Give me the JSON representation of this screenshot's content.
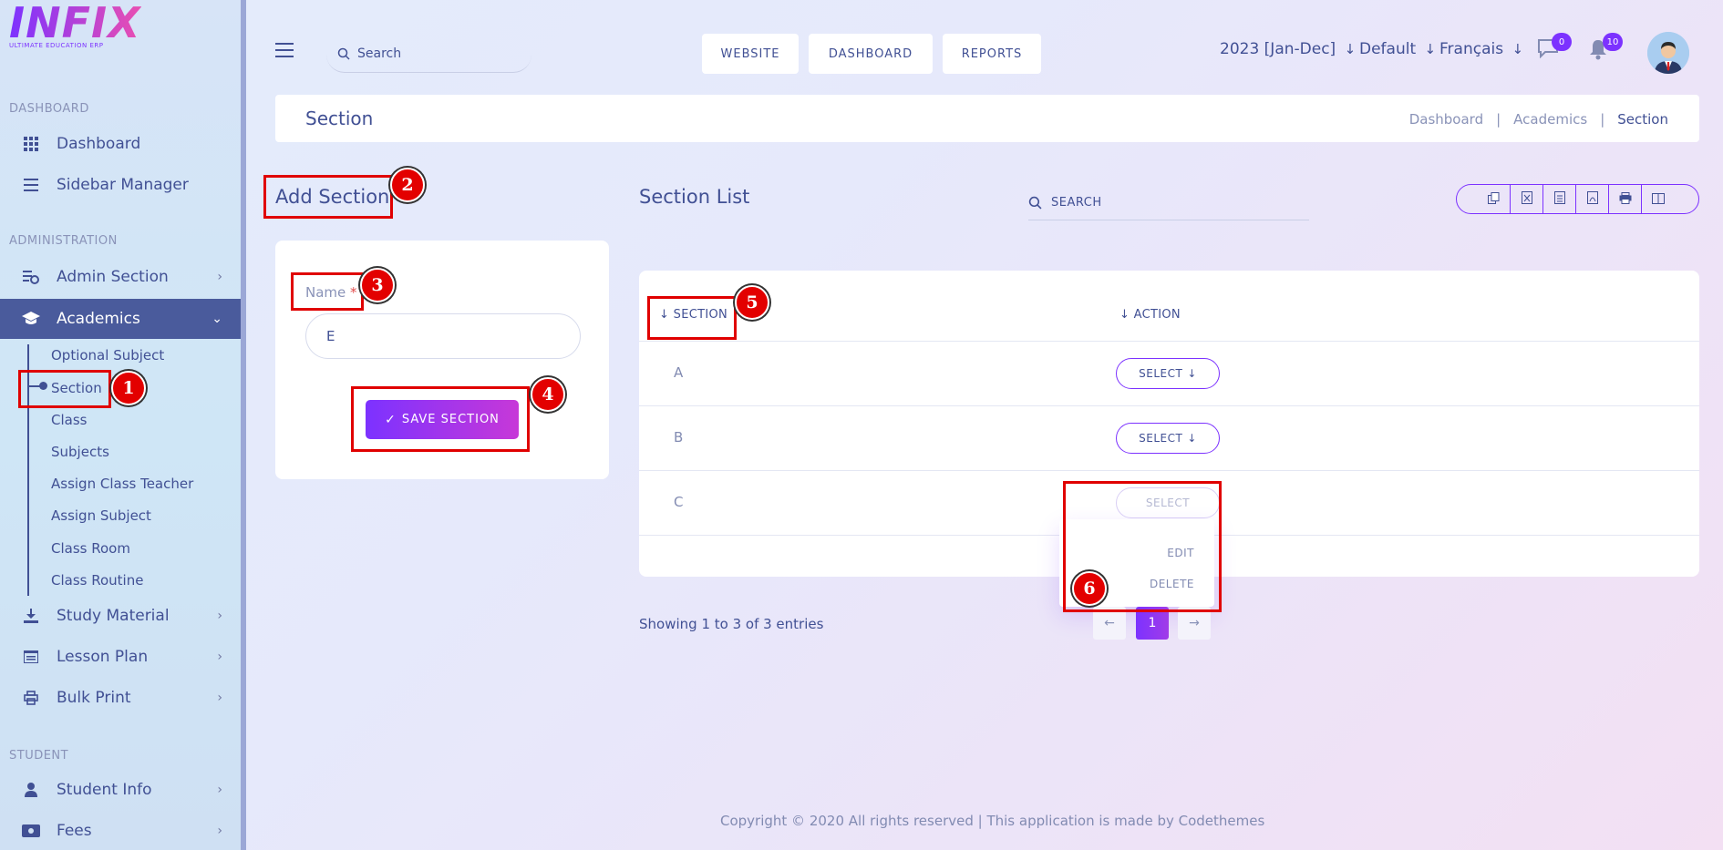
{
  "sidebar": {
    "logo_text": "INFIX",
    "logo_sub": "ULTIMATE EDUCATION ERP",
    "section_dashboard": "DASHBOARD",
    "item_dashboard": "Dashboard",
    "item_sidebar_manager": "Sidebar Manager",
    "section_administration": "ADMINISTRATION",
    "item_admin_section": "Admin Section",
    "item_academics": "Academics",
    "academics_sub": [
      "Optional Subject",
      "Section",
      "Class",
      "Subjects",
      "Assign Class Teacher",
      "Assign Subject",
      "Class Room",
      "Class Routine"
    ],
    "item_study_material": "Study Material",
    "item_lesson_plan": "Lesson Plan",
    "item_bulk_print": "Bulk Print",
    "section_student": "STUDENT",
    "item_student_info": "Student Info",
    "item_fees": "Fees"
  },
  "header": {
    "search_placeholder": "Search",
    "btn_website": "WEBSITE",
    "btn_dashboard": "DASHBOARD",
    "btn_reports": "REPORTS",
    "year": "2023 [Jan-Dec]",
    "theme": "Default",
    "language": "Français",
    "messages_count": "0",
    "notifications_count": "10"
  },
  "page": {
    "title": "Section",
    "breadcrumb": [
      "Dashboard",
      "Academics",
      "Section"
    ]
  },
  "add_section": {
    "heading": "Add Section",
    "name_label": "Name",
    "required_mark": "*",
    "name_value": "E",
    "save_label": "SAVE SECTION"
  },
  "section_list": {
    "heading": "Section List",
    "search_placeholder": "SEARCH",
    "col_section": "SECTION",
    "col_action": "ACTION",
    "rows": [
      {
        "section": "A",
        "action": "SELECT"
      },
      {
        "section": "B",
        "action": "SELECT"
      },
      {
        "section": "C",
        "action": "SELECT"
      }
    ],
    "dropdown_edit": "EDIT",
    "dropdown_delete": "DELETE",
    "entries_text": "Showing 1 to 3 of 3 entries",
    "page_current": "1"
  },
  "footer": {
    "text": "Copyright © 2020 All rights reserved | This application is made by Codethemes"
  },
  "annotations": [
    "1",
    "2",
    "3",
    "4",
    "5",
    "6"
  ],
  "colors": {
    "accent": "#7c32ff",
    "text": "#415094",
    "annotation": "#e00000",
    "active_nav": "#4a5b9c"
  }
}
